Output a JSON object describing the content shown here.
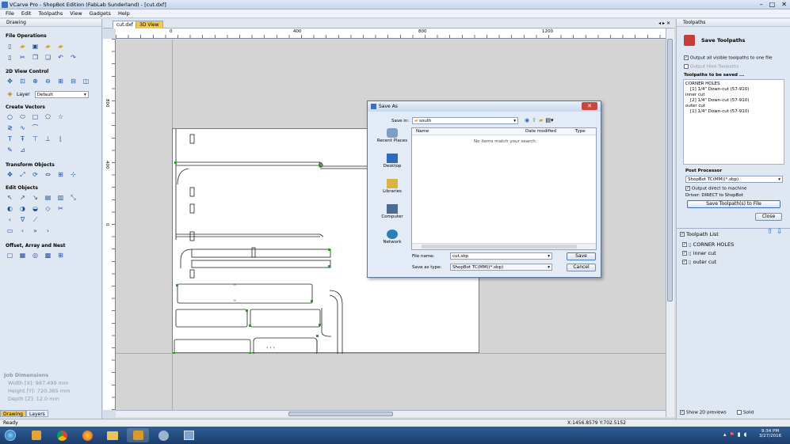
{
  "window": {
    "title": "VCarve Pro - ShopBot Edition (FabLab Sunderland) - [cut.dxf]"
  },
  "menu": [
    "File",
    "Edit",
    "Toolpaths",
    "View",
    "Gadgets",
    "Help"
  ],
  "left_panel": {
    "header": "Drawing",
    "sections": {
      "file_ops": "File Operations",
      "view_control": "2D View Control",
      "layer_label": "Layer",
      "layer_value": "Default",
      "create_vectors": "Create Vectors",
      "transform": "Transform Objects",
      "edit": "Edit Objects",
      "offset": "Offset, Array and Nest"
    },
    "job_dimensions": {
      "title": "Job Dimensions",
      "width": "Width  [X]: 987.499 mm",
      "height": "Height [Y]: 720.365 mm",
      "depth": "Depth  [Z]: 12.0 mm"
    },
    "tabs": [
      "Drawing",
      "Layers"
    ]
  },
  "doc_tabs": [
    "cut.dxf",
    "3D View"
  ],
  "rulers": {
    "top": [
      "0",
      "400",
      "800",
      "1200"
    ],
    "left": [
      "800",
      "400",
      "0"
    ]
  },
  "right_panel": {
    "header": "Toolpaths",
    "title": "Save Toolpaths",
    "opt_all": "Output all visible toolpaths to one file",
    "opt_visible": "Output Hied Toolpaths",
    "to_save_label": "Toolpaths to be saved ...",
    "toolpaths_saved": [
      "CORNER HOLES",
      "  [1] 1/4\" Down-cut (57-910)",
      "inner cut",
      "  [2] 1/4\" Down-cut (57-910)",
      "outer cut",
      "  [1] 1/4\" Down-cut (57-910)"
    ],
    "post_processor_label": "Post Processor",
    "post_processor_value": "ShopBot TC(MM)(*.sbp)",
    "output_direct": "Output direct to machine",
    "driver_note": "Driver: DIRECT to ShopBot",
    "save_button": "Save Toolpath(s) to File",
    "close_button": "Close",
    "toolpath_list_title": "Toolpath List",
    "toolpath_list": [
      "CORNER HOLES",
      "inner cut",
      "outer cut"
    ],
    "show_2d": "Show 2D previews",
    "solid": "Solid"
  },
  "dialog": {
    "title": "Save As",
    "save_in_label": "Save in:",
    "save_in_value": "south",
    "places": [
      "Recent Places",
      "Desktop",
      "Libraries",
      "Computer",
      "Network"
    ],
    "columns": [
      "Name",
      "Date modified",
      "Type"
    ],
    "empty_msg": "No items match your search.",
    "file_name_label": "File name:",
    "file_name_value": "cut.sbp",
    "save_type_label": "Save as type:",
    "save_type_value": "ShopBot TC(MM)(*.sbp)",
    "save_button": "Save",
    "cancel_button": "Cancel"
  },
  "status": {
    "left": "Ready",
    "coords": "X:1456.8579 Y:702.5152"
  },
  "clock": {
    "time": "9:34 PM",
    "date": "3/27/2016"
  }
}
